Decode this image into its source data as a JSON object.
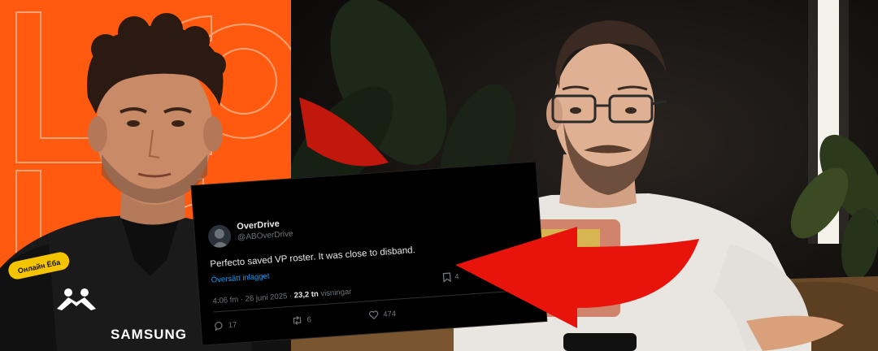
{
  "tweet": {
    "display_name": "OverDrive",
    "handle": "@ABOverDrive",
    "text": "Perfecto saved VP roster. It was close to disband.",
    "translate_label": "Översätt inlägget",
    "time": "4:06 fm · 26 juni 2025 · ",
    "views_count": "23,2 tn",
    "views_label": " visningar",
    "replies": "17",
    "reposts": "6",
    "likes": "474",
    "bookmarks": "4"
  },
  "left_photo": {
    "jersey_text": "SAMSUNG",
    "sponsor_text": "Онлайн Ёба",
    "kit_brand_icon": "kappa-logo-icon"
  },
  "colors": {
    "left_background": "#ff5a10",
    "arrow": "#e8140c",
    "tweet_background": "#000000",
    "link_blue": "#1d9bf0"
  }
}
